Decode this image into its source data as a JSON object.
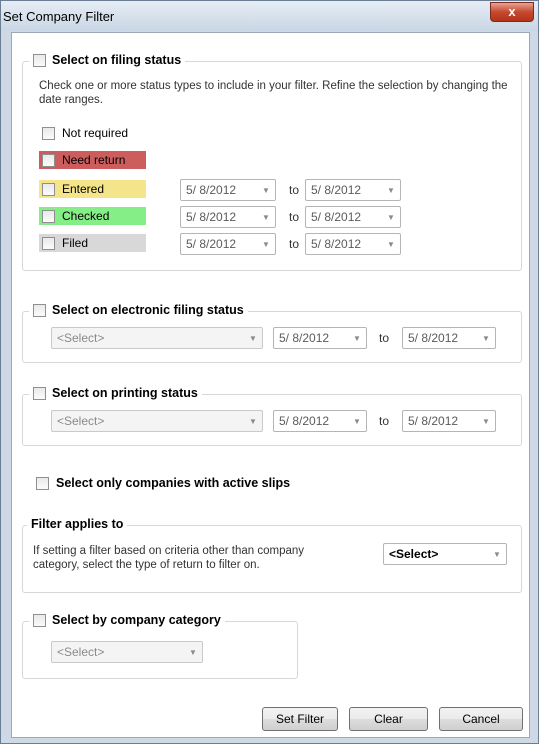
{
  "window": {
    "title": "Set Company Filter",
    "close_glyph": "x"
  },
  "filing_status": {
    "legend": "Select on filing status",
    "description": "Check one or more status types to include in your filter. Refine the selection by changing the date ranges.",
    "statuses": [
      {
        "label": "Not required",
        "color": "#ffffff"
      },
      {
        "label": "Need return",
        "color": "#cd5c5c"
      },
      {
        "label": "Entered",
        "color": "#f4e58a",
        "from": "5/ 8/2012",
        "to": "5/ 8/2012"
      },
      {
        "label": "Checked",
        "color": "#86ee86",
        "from": "5/ 8/2012",
        "to": "5/ 8/2012"
      },
      {
        "label": "Filed",
        "color": "#d8d8d8",
        "from": "5/ 8/2012",
        "to": "5/ 8/2012"
      }
    ],
    "to_label": "to"
  },
  "electronic": {
    "legend": "Select on electronic filing status",
    "select": "<Select>",
    "from": "5/ 8/2012",
    "to": "5/ 8/2012",
    "to_label": "to"
  },
  "printing": {
    "legend": "Select on printing status",
    "select": "<Select>",
    "from": "5/ 8/2012",
    "to": "5/ 8/2012",
    "to_label": "to"
  },
  "active_slips": {
    "label": "Select only companies with active slips"
  },
  "filter_applies": {
    "legend": "Filter applies to",
    "description": "If setting a filter based on criteria other than company category, select the type of return to filter on.",
    "select": "<Select>"
  },
  "category": {
    "legend": "Select by company category",
    "select": "<Select>"
  },
  "buttons": {
    "set_filter": "Set Filter",
    "clear": "Clear",
    "cancel": "Cancel"
  },
  "icons": {
    "dropdown": "chevron-down-icon"
  }
}
